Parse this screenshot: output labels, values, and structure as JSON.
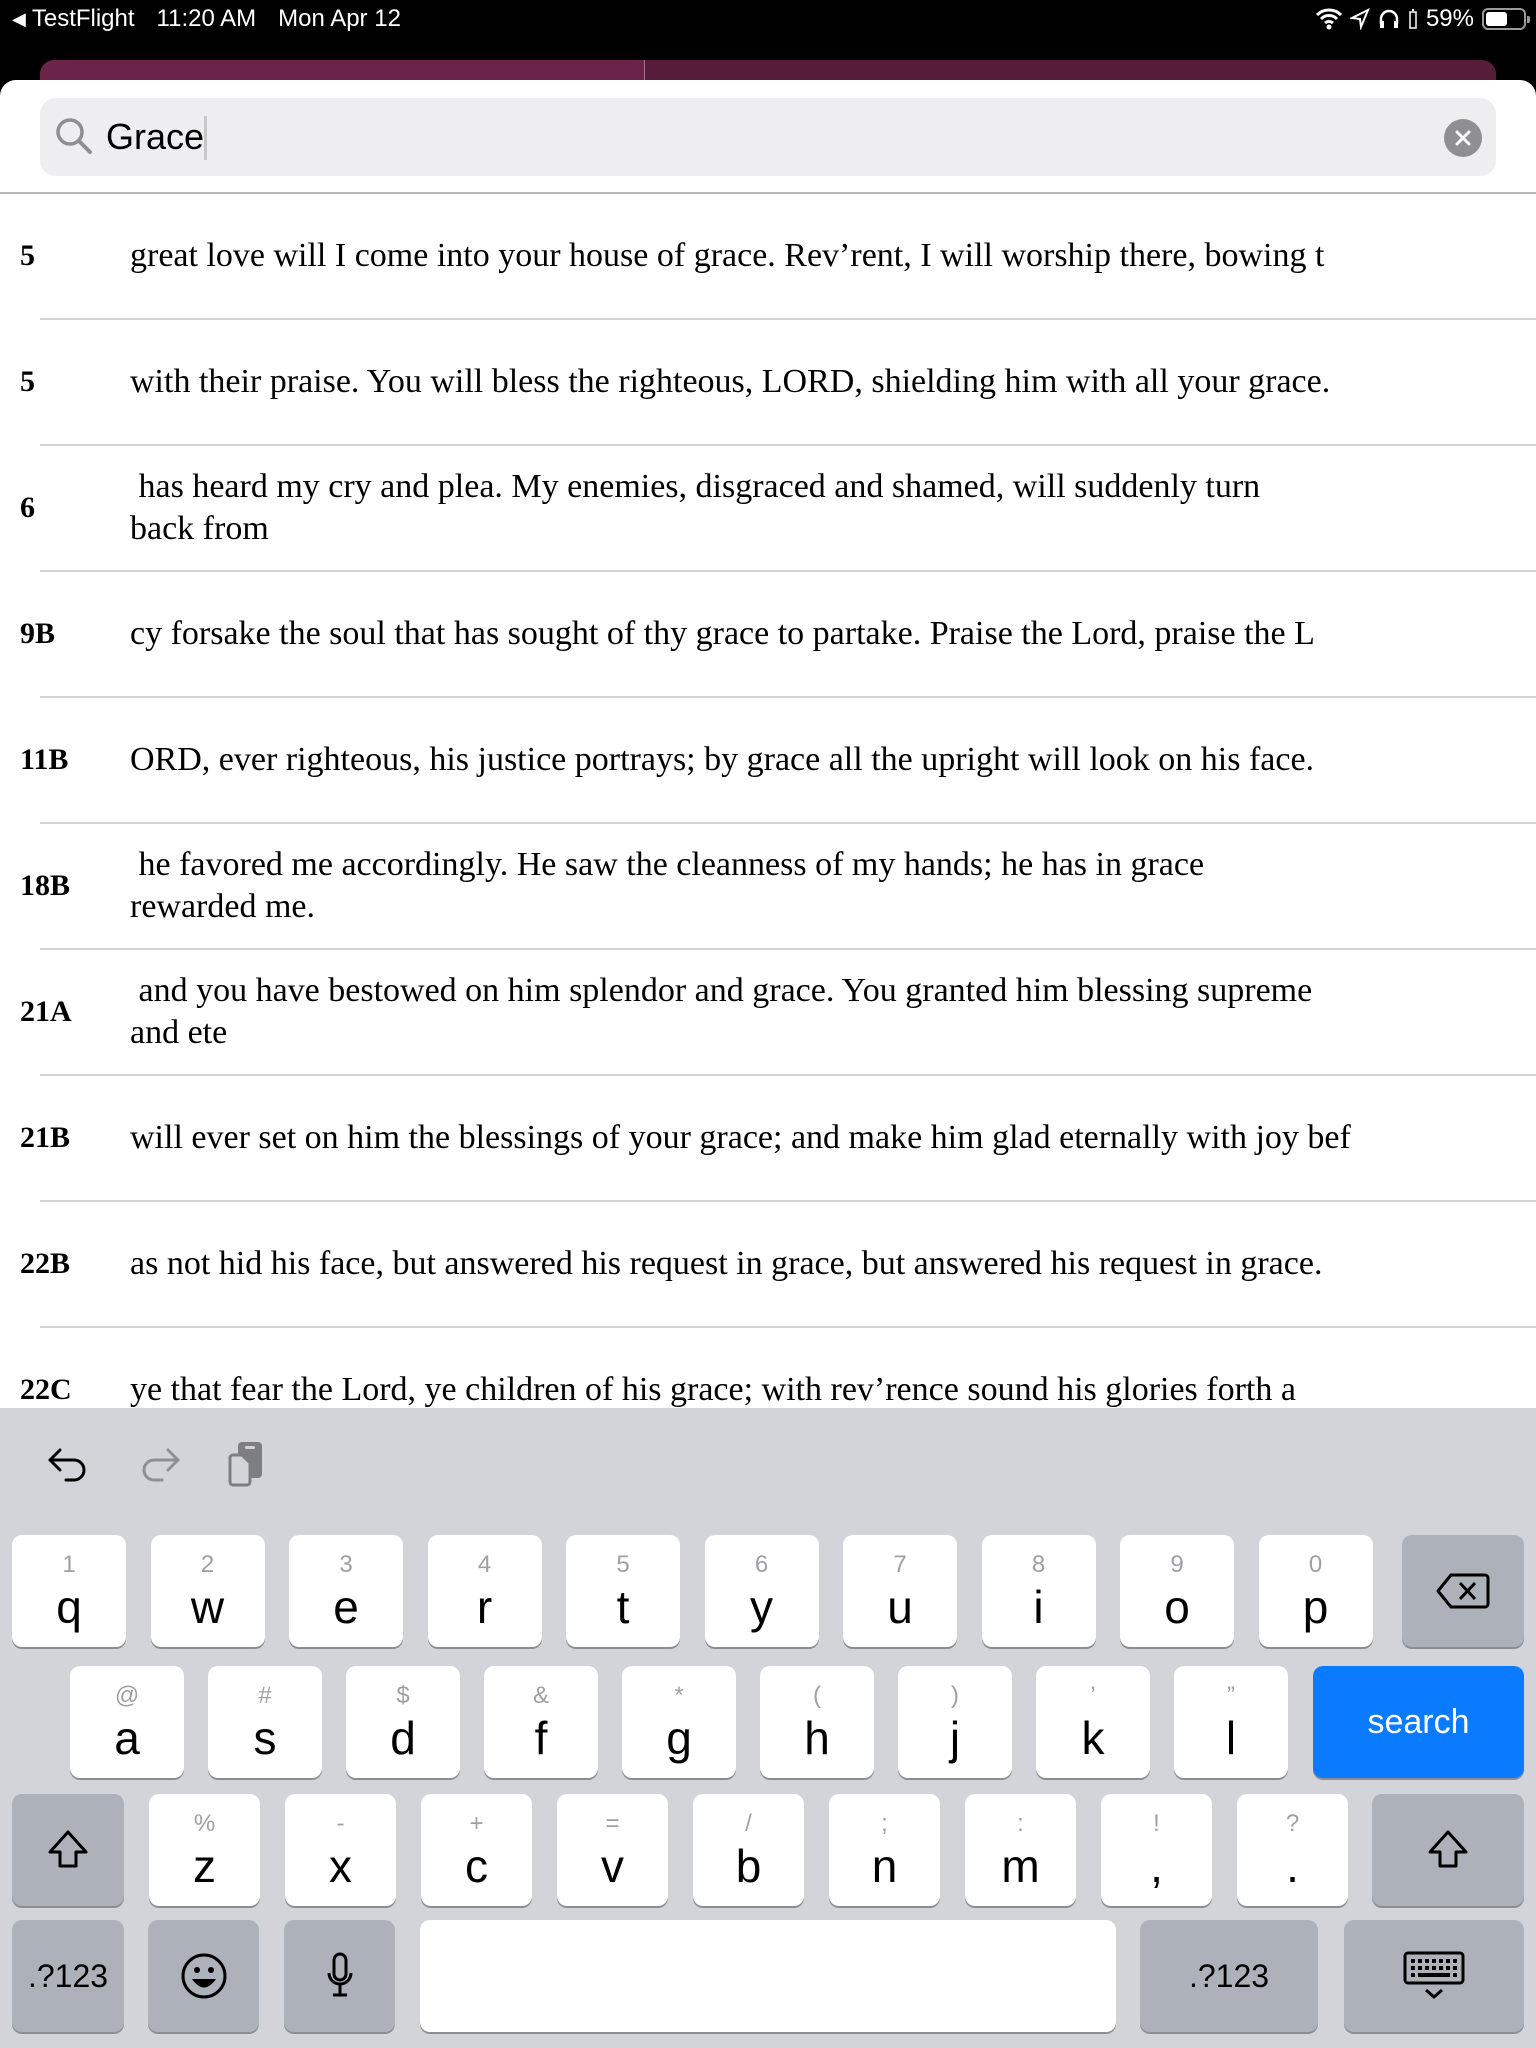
{
  "status_bar": {
    "back_app": "TestFlight",
    "time": "11:20 AM",
    "date": "Mon Apr 12",
    "battery": "59%",
    "battery_level": 0.59,
    "icons": [
      "wifi-icon",
      "location-icon",
      "headphones-icon",
      "battery-icon"
    ]
  },
  "colors": {
    "header_left": "#6b2349",
    "header_right": "#581c3b",
    "search_key": "#0a7bff",
    "keyboard_bg": "#d2d4d9"
  },
  "search": {
    "value": "Grace",
    "icon": "magnifier-icon",
    "clear_icon": "clear-x-icon"
  },
  "results": [
    {
      "num": "5",
      "text": "great love will I come into your house of grace. Rev’rent, I will worship there, bowing t",
      "lines": 1
    },
    {
      "num": "5",
      "text": "with their praise. You will bless the righteous, LORD, shielding him with all your grace.",
      "lines": 1
    },
    {
      "num": "6",
      "text": " has heard my cry and plea. My enemies, disgraced and shamed, will suddenly turn\nback from",
      "lines": 2
    },
    {
      "num": "9B",
      "text": "cy forsake the soul that has sought of thy grace to partake. Praise the Lord, praise the L",
      "lines": 1
    },
    {
      "num": "11B",
      "text": "ORD, ever righteous, his justice portrays; by grace all the upright will look on his face.",
      "lines": 1
    },
    {
      "num": "18B",
      "text": " he favored me accordingly. He saw the cleanness of my hands; he has in grace\nrewarded me.",
      "lines": 2
    },
    {
      "num": "21A",
      "text": " and you have bestowed on him splendor and grace. You granted him blessing supreme\nand ete",
      "lines": 2
    },
    {
      "num": "21B",
      "text": "will ever set on him the blessings of your grace; and make him glad eternally with joy bef",
      "lines": 1
    },
    {
      "num": "22B",
      "text": "as not hid his face, but answered his request in grace, but answered his request in grace.",
      "lines": 1
    },
    {
      "num": "22C",
      "text": " ye that fear the Lord, ye children of his grace; with rev’rence sound his glories forth a",
      "lines": 1
    }
  ],
  "keyboard": {
    "toolbar": [
      "undo-icon",
      "redo-icon",
      "paste-icon"
    ],
    "row1": [
      {
        "main": "q",
        "alt": "1"
      },
      {
        "main": "w",
        "alt": "2"
      },
      {
        "main": "e",
        "alt": "3"
      },
      {
        "main": "r",
        "alt": "4"
      },
      {
        "main": "t",
        "alt": "5"
      },
      {
        "main": "y",
        "alt": "6"
      },
      {
        "main": "u",
        "alt": "7"
      },
      {
        "main": "i",
        "alt": "8"
      },
      {
        "main": "o",
        "alt": "9"
      },
      {
        "main": "p",
        "alt": "0"
      }
    ],
    "row2": [
      {
        "main": "a",
        "alt": "@"
      },
      {
        "main": "s",
        "alt": "#"
      },
      {
        "main": "d",
        "alt": "$"
      },
      {
        "main": "f",
        "alt": "&"
      },
      {
        "main": "g",
        "alt": "*"
      },
      {
        "main": "h",
        "alt": "("
      },
      {
        "main": "j",
        "alt": ")"
      },
      {
        "main": "k",
        "alt": "’"
      },
      {
        "main": "l",
        "alt": "”"
      }
    ],
    "row3": [
      {
        "main": "z",
        "alt": "%"
      },
      {
        "main": "x",
        "alt": "-"
      },
      {
        "main": "c",
        "alt": "+"
      },
      {
        "main": "v",
        "alt": "="
      },
      {
        "main": "b",
        "alt": "/"
      },
      {
        "main": "n",
        "alt": ";"
      },
      {
        "main": "m",
        "alt": ":"
      },
      {
        "main": ",",
        "alt": "!"
      },
      {
        "main": ".",
        "alt": "?"
      }
    ],
    "search_label": "search",
    "numbers_label": ".?123",
    "space_label": ""
  }
}
